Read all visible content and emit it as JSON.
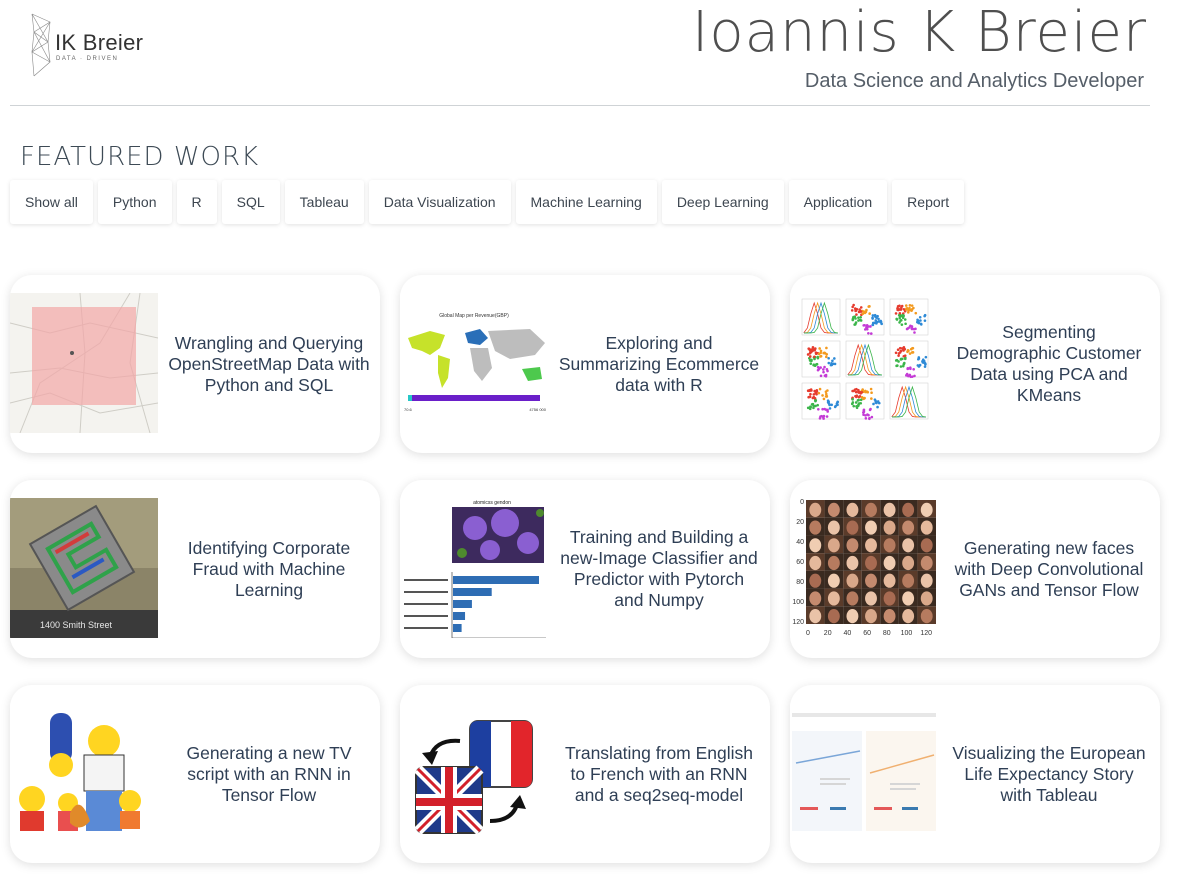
{
  "header": {
    "logo_name": "IK Breier",
    "logo_tagline": "DATA · DRIVEN",
    "title": "Ioannis K Breier",
    "subtitle": "Data Science and Analytics Developer"
  },
  "section": {
    "title": "FEATURED WORK"
  },
  "filters": [
    "Show all",
    "Python",
    "R",
    "SQL",
    "Tableau",
    "Data Visualization",
    "Machine Learning",
    "Deep Learning",
    "Application",
    "Report"
  ],
  "cards": [
    {
      "title": "Wrangling and Querying OpenStreetMap Data with Python and SQL",
      "thumb": "map-thumbnail"
    },
    {
      "title": "Exploring and Summarizing Ecommerce data with R",
      "thumb": "world-map-chart-thumbnail",
      "thumb_title": "Global Map per Revenue(GBP)",
      "thumb_min": "70.6",
      "thumb_max": "4756 000"
    },
    {
      "title": "Segmenting Demographic Customer Data using PCA and KMeans",
      "thumb": "scatter-matrix-thumbnail"
    },
    {
      "title": "Identifying Corporate Fraud with Machine Learning",
      "thumb": "enron-sign-thumbnail",
      "thumb_caption": "1400 Smith Street"
    },
    {
      "title": "Training and Building a new-Image Classifier and Predictor with Pytorch and Numpy",
      "thumb": "flower-classifier-thumbnail",
      "thumb_title": "atomicss gendon"
    },
    {
      "title": "Generating new faces with Deep Convolutional GANs and Tensor Flow",
      "thumb": "faces-grid-thumbnail",
      "axis_y": [
        "0",
        "20",
        "40",
        "60",
        "80",
        "100",
        "120"
      ],
      "axis_x": [
        "0",
        "20",
        "40",
        "60",
        "80",
        "100",
        "120"
      ]
    },
    {
      "title": "Generating a new TV script with an RNN in Tensor Flow",
      "thumb": "simpsons-thumbnail"
    },
    {
      "title": "Translating from English to French with an RNN and a seq2seq-model",
      "thumb": "flags-thumbnail"
    },
    {
      "title": "Visualizing the European Life Expectancy Story with Tableau",
      "thumb": "tableau-dashboard-thumbnail"
    }
  ],
  "colors": {
    "title_text": "#2f3f55",
    "rule": "#cfd3d6",
    "bar_blue": "#2e6db4"
  }
}
